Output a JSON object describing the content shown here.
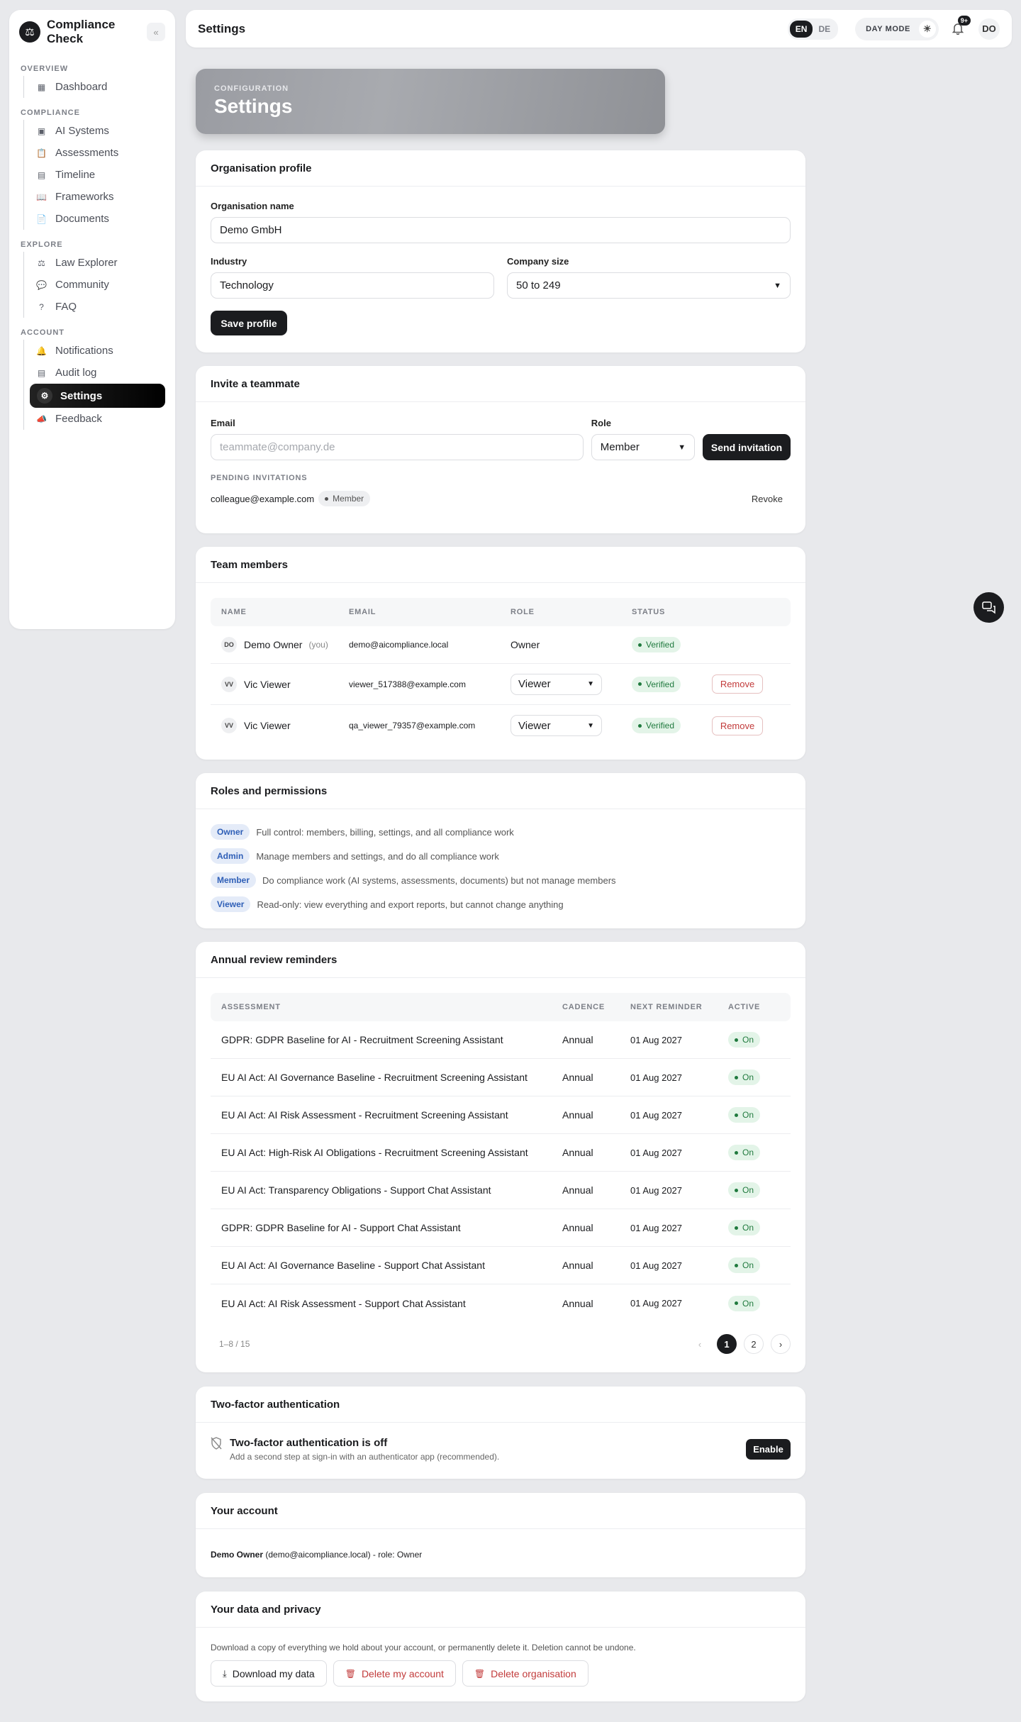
{
  "app": {
    "name": "Compliance Check",
    "collapse_icon": "«"
  },
  "sidebar": {
    "sections": [
      {
        "label": "OVERVIEW",
        "items": [
          {
            "label": "Dashboard",
            "icon": "grid-icon"
          }
        ]
      },
      {
        "label": "COMPLIANCE",
        "items": [
          {
            "label": "AI Systems",
            "icon": "chip-icon"
          },
          {
            "label": "Assessments",
            "icon": "clipboard-icon"
          },
          {
            "label": "Timeline",
            "icon": "calendar-icon"
          },
          {
            "label": "Frameworks",
            "icon": "book-icon"
          },
          {
            "label": "Documents",
            "icon": "document-icon"
          }
        ]
      },
      {
        "label": "EXPLORE",
        "items": [
          {
            "label": "Law Explorer",
            "icon": "scale-icon"
          },
          {
            "label": "Community",
            "icon": "chat-icon"
          },
          {
            "label": "FAQ",
            "icon": "help-icon"
          }
        ]
      },
      {
        "label": "ACCOUNT",
        "items": [
          {
            "label": "Notifications",
            "icon": "bell-icon"
          },
          {
            "label": "Audit log",
            "icon": "log-icon"
          },
          {
            "label": "Settings",
            "icon": "gear-icon",
            "active": true
          },
          {
            "label": "Feedback",
            "icon": "megaphone-icon"
          }
        ]
      }
    ]
  },
  "topbar": {
    "title": "Settings",
    "lang_en": "EN",
    "lang_de": "DE",
    "day_mode": "DAY MODE",
    "notif_badge": "9+",
    "avatar": "DO"
  },
  "hero": {
    "kicker": "CONFIGURATION",
    "title": "Settings"
  },
  "org_profile": {
    "title": "Organisation profile",
    "name_label": "Organisation name",
    "name_value": "Demo GmbH",
    "industry_label": "Industry",
    "industry_value": "Technology",
    "size_label": "Company size",
    "size_value": "50 to 249",
    "save": "Save profile"
  },
  "invite": {
    "title": "Invite a teammate",
    "email_label": "Email",
    "email_placeholder": "teammate@company.de",
    "role_label": "Role",
    "role_value": "Member",
    "send": "Send invitation",
    "pending_label": "PENDING INVITATIONS",
    "pending_email": "colleague@example.com",
    "pending_role": "Member",
    "revoke": "Revoke"
  },
  "team": {
    "title": "Team members",
    "headers": [
      "NAME",
      "EMAIL",
      "ROLE",
      "STATUS"
    ],
    "you_label": "(you)",
    "remove": "Remove",
    "rows": [
      {
        "initials": "DO",
        "name": "Demo Owner",
        "email": "demo@aicompliance.local",
        "role": "Owner",
        "status": "Verified",
        "is_you": true
      },
      {
        "initials": "VV",
        "name": "Vic Viewer",
        "email": "viewer_517388@example.com",
        "role": "Viewer",
        "status": "Verified"
      },
      {
        "initials": "VV",
        "name": "Vic Viewer",
        "email": "qa_viewer_79357@example.com",
        "role": "Viewer",
        "status": "Verified"
      }
    ]
  },
  "roles": {
    "title": "Roles and permissions",
    "items": [
      {
        "tag": "Owner",
        "desc": "Full control: members, billing, settings, and all compliance work"
      },
      {
        "tag": "Admin",
        "desc": "Manage members and settings, and do all compliance work"
      },
      {
        "tag": "Member",
        "desc": "Do compliance work (AI systems, assessments, documents) but not manage members"
      },
      {
        "tag": "Viewer",
        "desc": "Read-only: view everything and export reports, but cannot change anything"
      }
    ]
  },
  "reminders": {
    "title": "Annual review reminders",
    "headers": [
      "ASSESSMENT",
      "CADENCE",
      "NEXT REMINDER",
      "ACTIVE"
    ],
    "rows": [
      {
        "assessment": "GDPR: GDPR Baseline for AI - Recruitment Screening Assistant",
        "cadence": "Annual",
        "next": "01 Aug 2027",
        "active": "On"
      },
      {
        "assessment": "EU AI Act: AI Governance Baseline - Recruitment Screening Assistant",
        "cadence": "Annual",
        "next": "01 Aug 2027",
        "active": "On"
      },
      {
        "assessment": "EU AI Act: AI Risk Assessment - Recruitment Screening Assistant",
        "cadence": "Annual",
        "next": "01 Aug 2027",
        "active": "On"
      },
      {
        "assessment": "EU AI Act: High-Risk AI Obligations - Recruitment Screening Assistant",
        "cadence": "Annual",
        "next": "01 Aug 2027",
        "active": "On"
      },
      {
        "assessment": "EU AI Act: Transparency Obligations - Support Chat Assistant",
        "cadence": "Annual",
        "next": "01 Aug 2027",
        "active": "On"
      },
      {
        "assessment": "GDPR: GDPR Baseline for AI - Support Chat Assistant",
        "cadence": "Annual",
        "next": "01 Aug 2027",
        "active": "On"
      },
      {
        "assessment": "EU AI Act: AI Governance Baseline - Support Chat Assistant",
        "cadence": "Annual",
        "next": "01 Aug 2027",
        "active": "On"
      },
      {
        "assessment": "EU AI Act: AI Risk Assessment - Support Chat Assistant",
        "cadence": "Annual",
        "next": "01 Aug 2027",
        "active": "On"
      }
    ],
    "range": "1–8 / 15",
    "page1": "1",
    "page2": "2"
  },
  "twofa": {
    "title": "Two-factor authentication",
    "status": "Two-factor authentication is off",
    "hint": "Add a second step at sign-in with an authenticator app (recommended).",
    "enable": "Enable"
  },
  "account": {
    "title": "Your account",
    "name": "Demo Owner",
    "detail": " (demo@aicompliance.local) - role: Owner"
  },
  "privacy": {
    "title": "Your data and privacy",
    "desc": "Download a copy of everything we hold about your account, or permanently delete it. Deletion cannot be undone.",
    "download": "Download my data",
    "delete_account": "Delete my account",
    "delete_org": "Delete organisation"
  }
}
